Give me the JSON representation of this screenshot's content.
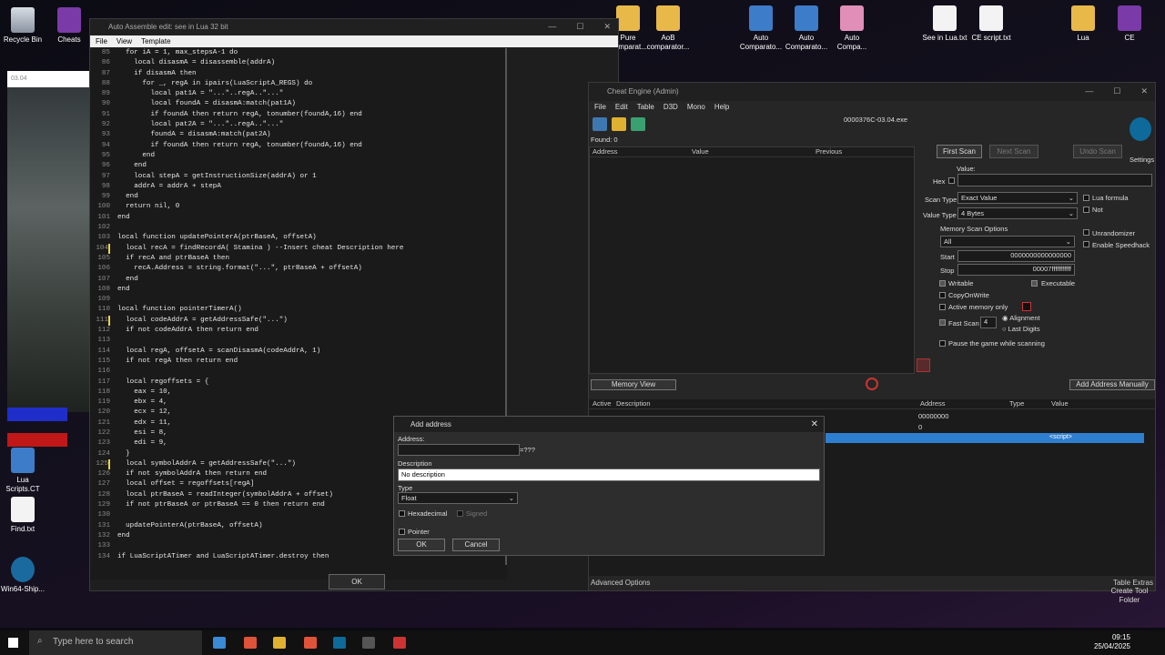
{
  "desktop_icons": [
    {
      "label": "Recycle Bin",
      "icon": "recycle-bin-icon"
    },
    {
      "label": "Cheats",
      "icon": "folder-icon"
    },
    {
      "label": "Pure\nComparat...",
      "icon": "folder-icon"
    },
    {
      "label": "AoB\ncomparator...",
      "icon": "folder-icon"
    },
    {
      "label": "Auto\nComparato...",
      "icon": "app-icon"
    },
    {
      "label": "Auto\nComparato...",
      "icon": "app-icon"
    },
    {
      "label": "Auto\nCompa...",
      "icon": "app-icon"
    },
    {
      "label": "See in Lua.txt",
      "icon": "text-file-icon"
    },
    {
      "label": "CE script.txt",
      "icon": "text-file-icon"
    },
    {
      "label": "Lua",
      "icon": "folder-icon"
    },
    {
      "label": "CE",
      "icon": "folder-icon"
    },
    {
      "label": "Lua\nScripts.CT",
      "icon": "ce-table-icon"
    },
    {
      "label": "Find.txt",
      "icon": "text-file-icon"
    },
    {
      "label": "Win64-Ship...",
      "icon": "gear-icon"
    }
  ],
  "photo_caption": "03.04",
  "lua_editor": {
    "title": "Auto Assemble edit: see in Lua 32 bit",
    "menu": [
      "File",
      "View",
      "Template"
    ],
    "ok_label": "OK",
    "lines": [
      {
        "n": "85",
        "t": "  for iA = 1, max_stepsA-1 do"
      },
      {
        "n": "86",
        "t": "    local disasmA = disassemble(addrA)"
      },
      {
        "n": "87",
        "t": "    if disasmA then"
      },
      {
        "n": "88",
        "t": "      for _, regA in ipairs(LuaScriptA_REGS) do"
      },
      {
        "n": "89",
        "t": "        local pat1A = \"...\"..regA..\"...\""
      },
      {
        "n": "90",
        "t": "        local foundA = disasmA:match(pat1A)"
      },
      {
        "n": "91",
        "t": "        if foundA then return regA, tonumber(foundA,16) end"
      },
      {
        "n": "92",
        "t": "        local pat2A = \"...\"..regA..\"...\""
      },
      {
        "n": "93",
        "t": "        foundA = disasmA:match(pat2A)"
      },
      {
        "n": "94",
        "t": "        if foundA then return regA, tonumber(foundA,16) end"
      },
      {
        "n": "95",
        "t": "      end"
      },
      {
        "n": "96",
        "t": "    end"
      },
      {
        "n": "97",
        "t": "    local stepA = getInstructionSize(addrA) or 1"
      },
      {
        "n": "98",
        "t": "    addrA = addrA + stepA"
      },
      {
        "n": "99",
        "t": "  end"
      },
      {
        "n": "100",
        "t": "  return nil, 0"
      },
      {
        "n": "101",
        "t": "end"
      },
      {
        "n": "102",
        "t": ""
      },
      {
        "n": "103",
        "t": "local function updatePointerA(ptrBaseA, offsetA)"
      },
      {
        "n": "104",
        "t": "  local recA = findRecordA( Stamina ) --Insert cheat Description here"
      },
      {
        "n": "105",
        "t": "  if recA and ptrBaseA then"
      },
      {
        "n": "106",
        "t": "    recA.Address = string.format(\"...\", ptrBaseA + offsetA)"
      },
      {
        "n": "107",
        "t": "  end"
      },
      {
        "n": "108",
        "t": "end"
      },
      {
        "n": "109",
        "t": ""
      },
      {
        "n": "110",
        "t": "local function pointerTimerA()"
      },
      {
        "n": "111",
        "t": "  local codeAddrA = getAddressSafe(\"...\")"
      },
      {
        "n": "112",
        "t": "  if not codeAddrA then return end"
      },
      {
        "n": "113",
        "t": ""
      },
      {
        "n": "114",
        "t": "  local regA, offsetA = scanDisasmA(codeAddrA, 1)"
      },
      {
        "n": "115",
        "t": "  if not regA then return end"
      },
      {
        "n": "116",
        "t": ""
      },
      {
        "n": "117",
        "t": "  local regoffsets = {"
      },
      {
        "n": "118",
        "t": "    eax = 10,"
      },
      {
        "n": "119",
        "t": "    ebx = 4,"
      },
      {
        "n": "120",
        "t": "    ecx = 12,"
      },
      {
        "n": "121",
        "t": "    edx = 11,"
      },
      {
        "n": "122",
        "t": "    esi = 8,"
      },
      {
        "n": "123",
        "t": "    edi = 9,"
      },
      {
        "n": "124",
        "t": "  }"
      },
      {
        "n": "125",
        "t": "  local symbolAddrA = getAddressSafe(\"...\")"
      },
      {
        "n": "126",
        "t": "  if not symbolAddrA then return end"
      },
      {
        "n": "127",
        "t": "  local offset = regoffsets[regA]"
      },
      {
        "n": "128",
        "t": "  local ptrBaseA = readInteger(symbolAddrA + offset)"
      },
      {
        "n": "129",
        "t": "  if not ptrBaseA or ptrBaseA == 0 then return end"
      },
      {
        "n": "130",
        "t": ""
      },
      {
        "n": "131",
        "t": "  updatePointerA(ptrBaseA, offsetA)"
      },
      {
        "n": "132",
        "t": "end"
      },
      {
        "n": "133",
        "t": ""
      },
      {
        "n": "134",
        "t": "if LuaScriptATimer and LuaScriptATimer.destroy then"
      }
    ]
  },
  "cheat_engine": {
    "title": "Cheat Engine (Admin)",
    "menu": [
      "File",
      "Edit",
      "Table",
      "D3D",
      "Mono",
      "Help"
    ],
    "process": "0000376C-03.04.exe",
    "found": "Found: 0",
    "result_columns": [
      "Address",
      "Value",
      "Previous"
    ],
    "first_scan": "First Scan",
    "next_scan": "Next Scan",
    "undo_scan": "Undo Scan",
    "settings": "Settings",
    "value_label": "Value:",
    "hex": "Hex",
    "scan_type_label": "Scan Type",
    "scan_type": "Exact Value",
    "value_type_label": "Value Type",
    "value_type": "4 Bytes",
    "lua_formula": "Lua formula",
    "not": "Not",
    "memory_scan_options": "Memory Scan Options",
    "region": "All",
    "start_label": "Start",
    "start": "0000000000000000",
    "stop_label": "Stop",
    "stop": "00007fffffffffff",
    "writable": "Writable",
    "executable": "Executable",
    "copyonwrite": "CopyOnWrite",
    "active_memory": "Active memory only",
    "fast_scan": "Fast Scan",
    "fast_scan_value": "4",
    "alignment": "Alignment",
    "last_digits": "Last Digits",
    "unrandomizer": "Unrandomizer",
    "speedhack": "Enable Speedhack",
    "pause_game": "Pause the game while scanning",
    "memory_view": "Memory View",
    "add_manually": "Add Address Manually",
    "list_columns": [
      "Active",
      "Description",
      "Address",
      "Type",
      "Value"
    ],
    "row_addr": "00000000",
    "row_zero": "0",
    "script_value": "<script>",
    "advanced": "Advanced Options",
    "table_extras": "Table Extras",
    "create_folder": "Create Tool\nFolder"
  },
  "dialog": {
    "title": "Add address",
    "address_label": "Address:",
    "address_value": "",
    "address_result": "=???",
    "description_label": "Description",
    "description_value": "No description",
    "type_label": "Type",
    "type_value": "Float",
    "hexadecimal": "Hexadecimal",
    "signed": "Signed",
    "pointer": "Pointer",
    "ok": "OK",
    "cancel": "Cancel"
  },
  "taskbar": {
    "search_placeholder": "Type here to search",
    "time": "09:15",
    "date": "25/04/2025"
  }
}
